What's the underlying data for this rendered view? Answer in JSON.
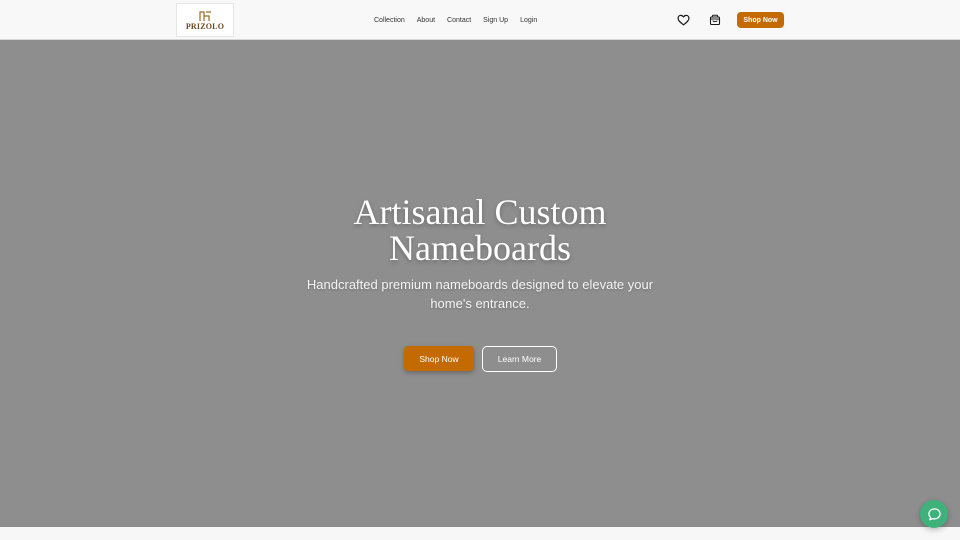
{
  "brand": {
    "name": "PRIZOLO",
    "accent_color": "#c36a03",
    "logo_color": "#6b4a1c"
  },
  "nav": {
    "links": [
      "Collection",
      "About",
      "Contact",
      "Sign Up",
      "Login"
    ],
    "wishlist_icon": "heart-icon",
    "cart_icon": "shopping-bag-icon",
    "shop_button": "Shop Now"
  },
  "hero": {
    "title": "Artisanal Custom Nameboards",
    "subtitle": "Handcrafted premium nameboards designed to elevate your home's entrance.",
    "primary_button": "Shop Now",
    "secondary_button": "Learn More",
    "background_color": "#8e8e8e"
  },
  "chat": {
    "icon": "chat-bubble-icon",
    "color": "#3fb27c"
  }
}
